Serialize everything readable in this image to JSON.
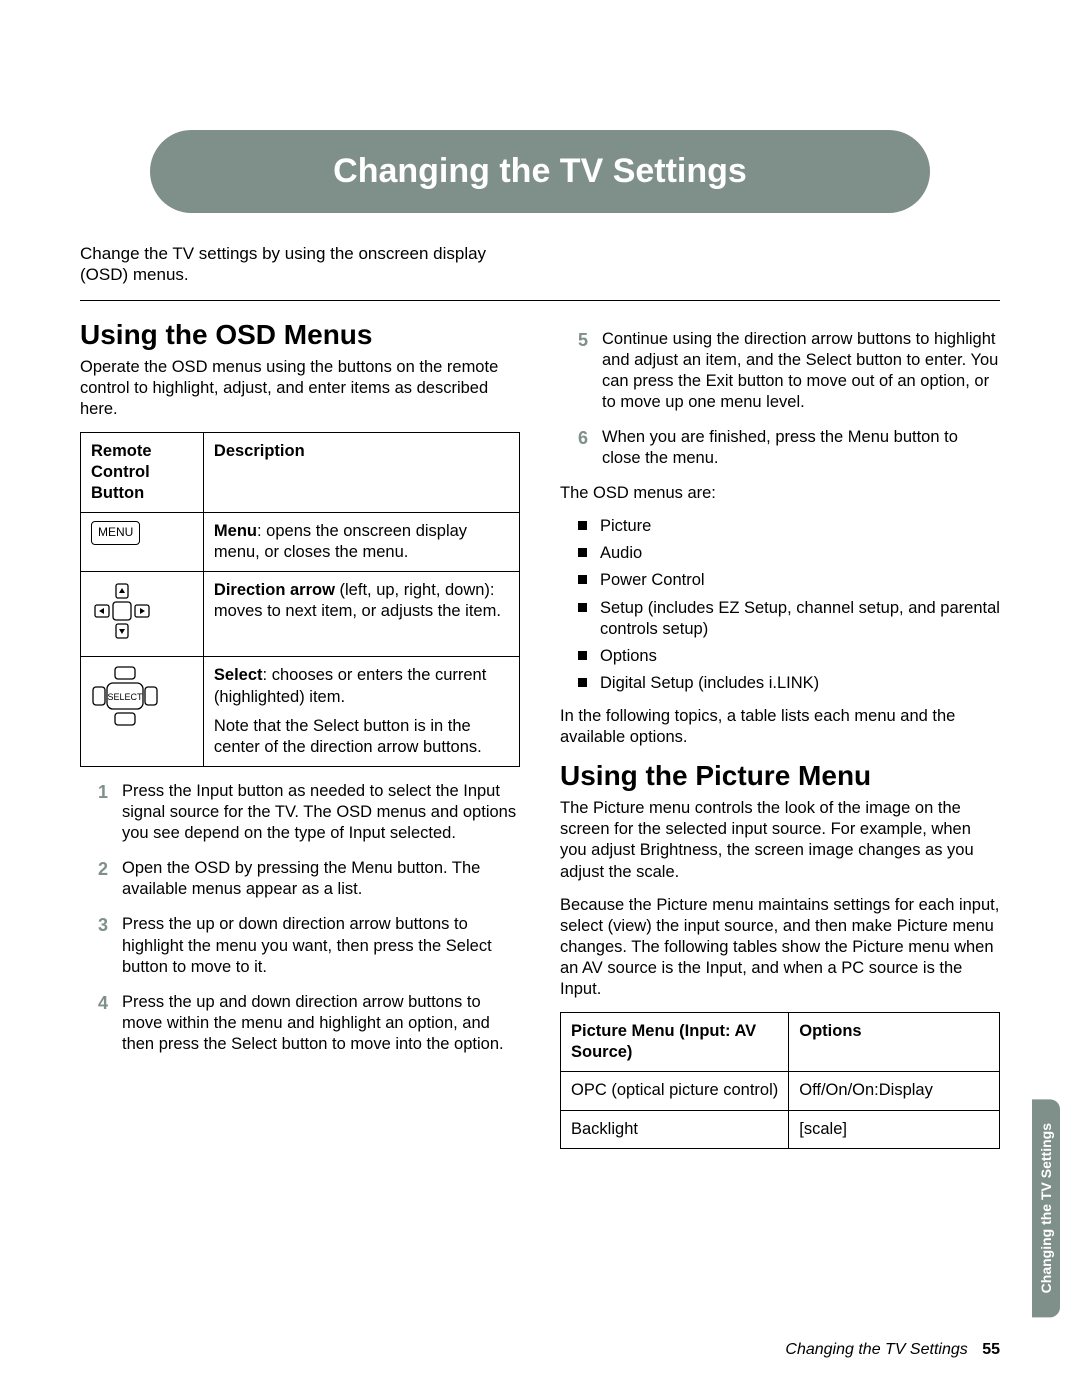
{
  "chapter_title": "Changing the TV Settings",
  "intro": "Change the TV settings by using the onscreen display (OSD) menus.",
  "left": {
    "heading": "Using the OSD Menus",
    "intro": "Operate the OSD menus using the buttons on the remote control to highlight, adjust, and enter items as described here.",
    "table_header_col1": "Remote Control Button",
    "table_header_col2": "Description",
    "row_menu_icon_label": "MENU",
    "row_menu_desc_bold": "Menu",
    "row_menu_desc_rest": ": opens the onscreen display menu, or closes the menu.",
    "row_arrow_desc_bold": "Direction arrow",
    "row_arrow_desc_rest": " (left, up, right, down): moves to next item, or adjusts the item.",
    "row_select_icon_label": "SELECT",
    "row_select_desc_bold": "Select",
    "row_select_desc_rest": ": chooses or enters the current (highlighted) item.",
    "row_select_note": "Note that the Select button is in the center of the direction arrow buttons.",
    "steps": {
      "s1": "Press the Input button as needed to select the Input signal source for the TV. The OSD menus and options you see depend on the type of Input selected.",
      "s2": "Open the OSD by pressing the Menu button. The available menus appear as a list.",
      "s3": "Press the up or down direction arrow buttons to highlight the menu you want, then press the Select button to move to it.",
      "s4": "Press the up and down direction arrow buttons to move within the menu and highlight an option, and then press the Select button to move into the option."
    }
  },
  "right": {
    "steps": {
      "s5": "Continue using the direction arrow buttons to highlight and adjust an item, and the Select button to enter. You can press the Exit button to move out of an option, or to move up one menu level.",
      "s6": "When you are finished, press the Menu button to close the menu."
    },
    "osd_intro": "The OSD menus are:",
    "osd_items": {
      "i1": "Picture",
      "i2": "Audio",
      "i3": "Power Control",
      "i4": "Setup (includes EZ Setup, channel setup, and parental controls setup)",
      "i5": "Options",
      "i6": "Digital Setup (includes i.LINK)"
    },
    "osd_outro": "In the following topics, a table lists each menu and the available options.",
    "picture_heading": "Using the Picture Menu",
    "picture_p1": "The Picture menu controls the look of the image on the screen for the selected input source. For example, when you adjust Brightness, the screen image changes as you adjust the scale.",
    "picture_p2": "Because the Picture menu maintains settings for each input, select (view) the input source, and then make Picture menu changes. The following tables show the Picture menu when an AV source is the Input, and when a PC source is the Input.",
    "ptable_head_col1": "Picture Menu (Input: AV Source)",
    "ptable_head_col2": "Options",
    "ptable_r1c1": "OPC (optical picture control)",
    "ptable_r1c2": "Off/On/On:Display",
    "ptable_r2c1": "Backlight",
    "ptable_r2c2": "[scale]"
  },
  "side_tab": "Changing the TV Settings",
  "footer_title": "Changing the TV Settings",
  "footer_page": "55"
}
